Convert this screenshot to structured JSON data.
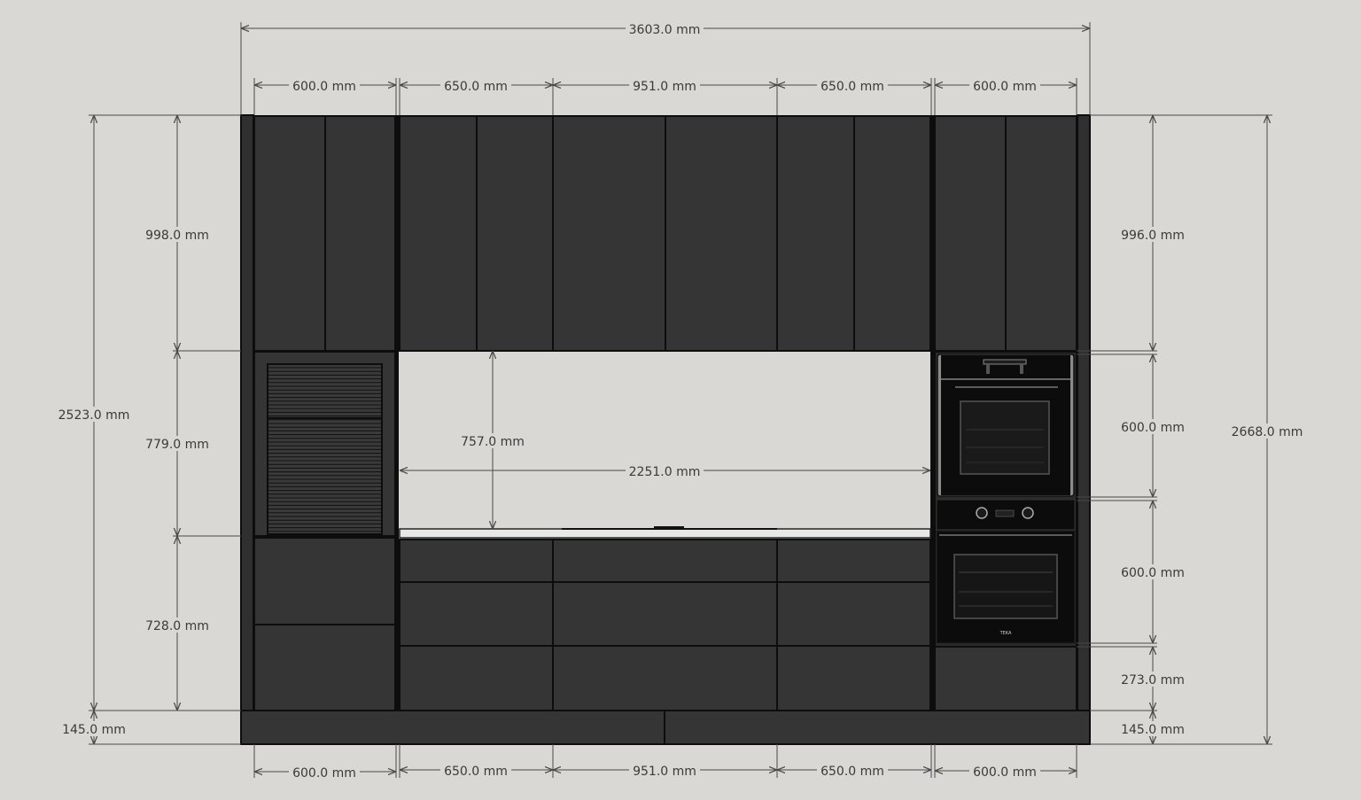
{
  "dimensions": {
    "overall_width": "3603.0 mm",
    "top_row": [
      "600.0 mm",
      "650.0 mm",
      "951.0 mm",
      "650.0 mm",
      "600.0 mm"
    ],
    "bottom_row": [
      "600.0 mm",
      "650.0 mm",
      "951.0 mm",
      "650.0 mm",
      "600.0 mm"
    ],
    "left_overall_height": "2523.0 mm",
    "left_upper": "998.0 mm",
    "left_middle": "779.0 mm",
    "left_lower": "728.0 mm",
    "left_plinth": "145.0 mm",
    "backsplash_height": "757.0 mm",
    "countertop_width": "2251.0 mm",
    "right_upper": "996.0 mm",
    "right_oven_top": "600.0 mm",
    "right_oven_bottom": "600.0 mm",
    "right_base": "273.0 mm",
    "right_plinth": "145.0 mm",
    "right_overall_height": "2668.0 mm"
  },
  "colors": {
    "background": "#d9d8d4",
    "cabinet": "#353535",
    "outline": "#0d0d0d",
    "dimension_line": "#4a4a4a",
    "oven_glass": "#1a1a1a",
    "countertop": "#e8e8e6"
  },
  "oven_brand": "TEKA"
}
